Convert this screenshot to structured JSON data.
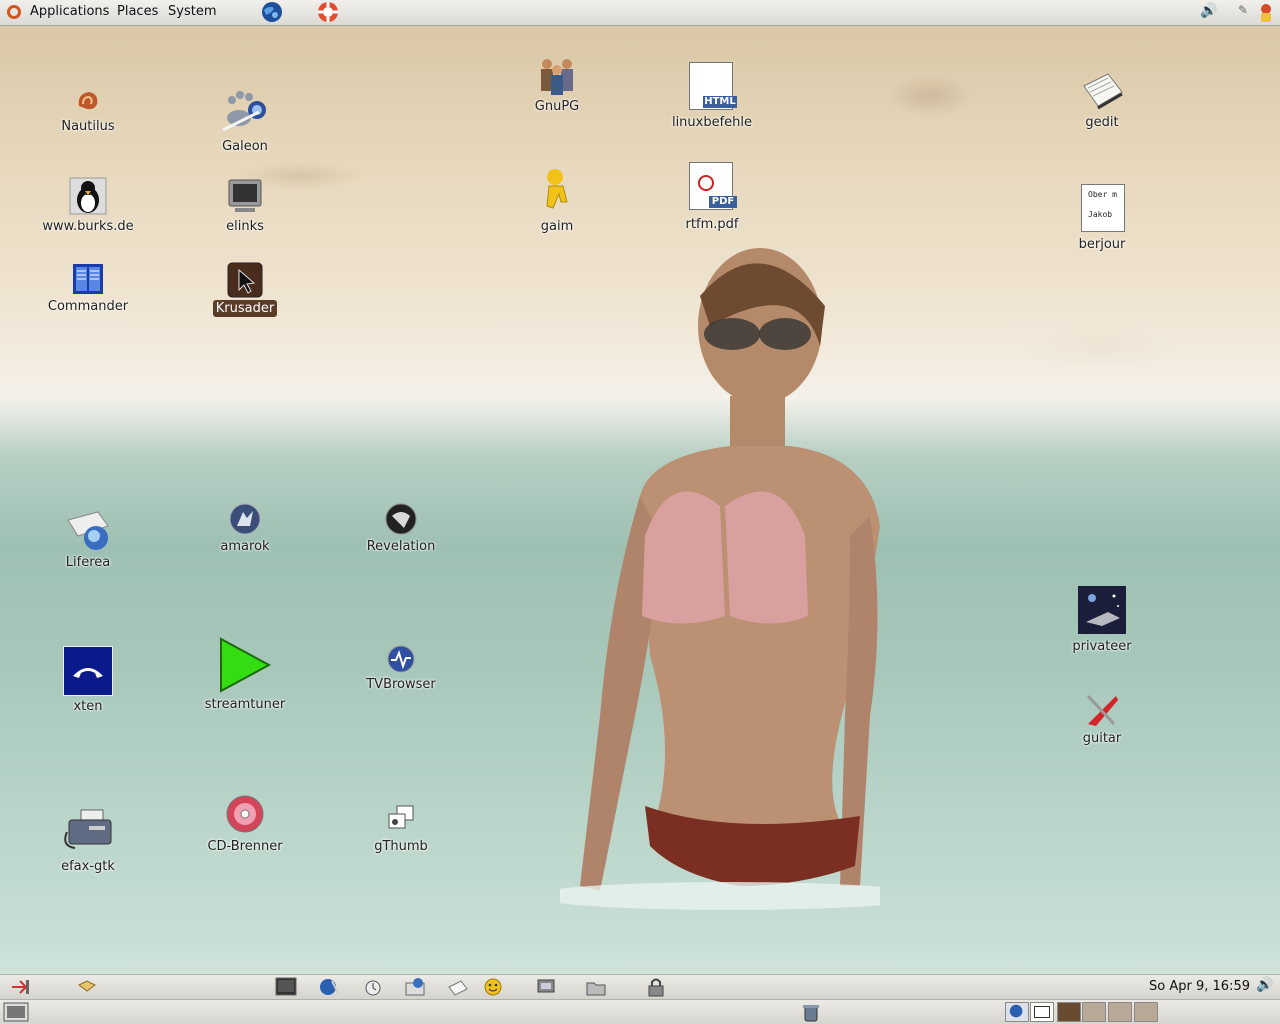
{
  "top_panel": {
    "menus": [
      "Applications",
      "Places",
      "System"
    ]
  },
  "desktop": {
    "icons": [
      {
        "label": "Nautilus"
      },
      {
        "label": "Galeon"
      },
      {
        "label": "GnuPG"
      },
      {
        "label": "linuxbefehle"
      },
      {
        "label": "gedit"
      },
      {
        "label": "www.burks.de"
      },
      {
        "label": "elinks"
      },
      {
        "label": "gaim"
      },
      {
        "label": "rtfm.pdf"
      },
      {
        "label": "berjour"
      },
      {
        "label": "Commander"
      },
      {
        "label": "Krusader"
      },
      {
        "label": "Liferea"
      },
      {
        "label": "amarok"
      },
      {
        "label": "Revelation"
      },
      {
        "label": "privateer"
      },
      {
        "label": "xten"
      },
      {
        "label": "streamtuner"
      },
      {
        "label": "TVBrowser"
      },
      {
        "label": "guitar"
      },
      {
        "label": "efax-gtk"
      },
      {
        "label": "CD-Brenner"
      },
      {
        "label": "gThumb"
      }
    ],
    "html_badge": "HTML",
    "pdf_badge": "PDF",
    "note_text": [
      "Ober m",
      "Jakob"
    ]
  },
  "bottom_panel": {
    "clock": "So Apr  9, 16:59"
  },
  "colors": {
    "selection": "#5a3c28",
    "panel": "#dcdad5",
    "xten_blue": "#0a1a8a",
    "streamtuner_green": "#33dd11"
  }
}
